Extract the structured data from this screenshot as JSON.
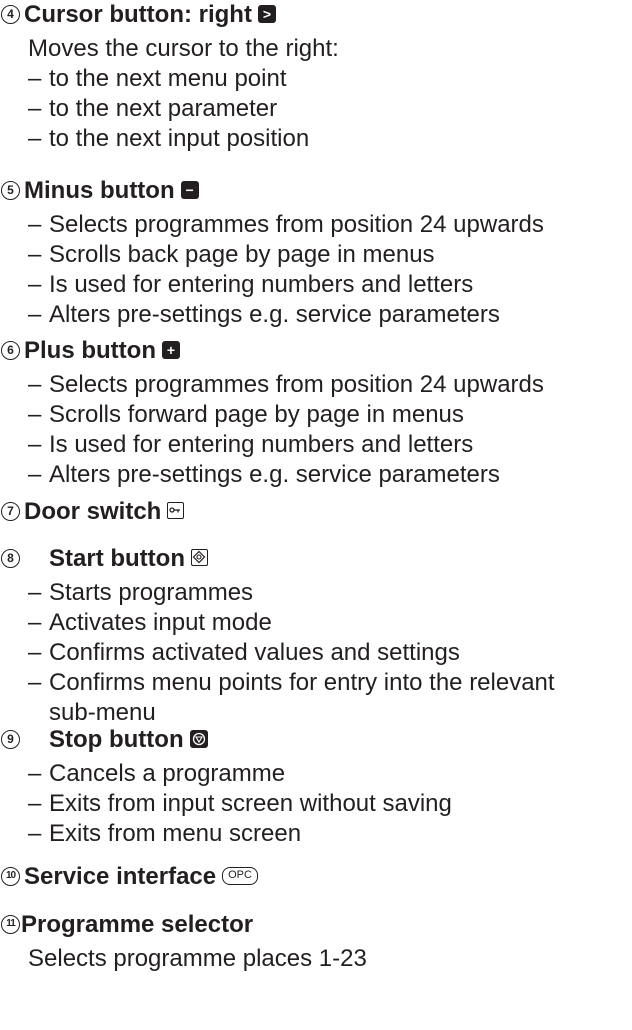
{
  "sections": [
    {
      "number": "4",
      "title": "Cursor button: right",
      "icon": "arrow-right-box-icon",
      "description": "Moves the cursor to the right:",
      "bullets": [
        "to the next menu point",
        "to the next parameter",
        "to the next input position"
      ]
    },
    {
      "number": "5",
      "title": "Minus button",
      "icon": "minus-box-icon",
      "bullets": [
        "Selects programmes from position 24 upwards",
        "Scrolls back page by page in menus",
        "Is used for entering numbers and letters",
        "Alters pre-settings e.g. service parameters"
      ]
    },
    {
      "number": "6",
      "title": "Plus button",
      "icon": "plus-box-icon",
      "bullets": [
        "Selects programmes from position 24 upwards",
        "Scrolls forward page by page in menus",
        "Is used for entering numbers and letters",
        "Alters pre-settings e.g. service parameters"
      ]
    },
    {
      "number": "7",
      "title": "Door switch",
      "icon": "key-icon"
    },
    {
      "number": "8",
      "title": "Start button",
      "icon": "start-diamond-icon",
      "bullets": [
        "Starts programmes",
        "Activates input mode",
        "Confirms activated values and settings",
        "Confirms menu points for entry into the relevant",
        "sub-menu"
      ]
    },
    {
      "number": "9",
      "title": "Stop button",
      "icon": "stop-icon",
      "bullets": [
        "Cancels a programme",
        "Exits from input screen without saving",
        "Exits from menu screen"
      ]
    },
    {
      "number": "10",
      "title": "Service interface",
      "icon": "opc-icon",
      "icon_text": "OPC"
    },
    {
      "number": "11",
      "title": "Programme selector",
      "description": "Selects programme places 1-23"
    }
  ]
}
